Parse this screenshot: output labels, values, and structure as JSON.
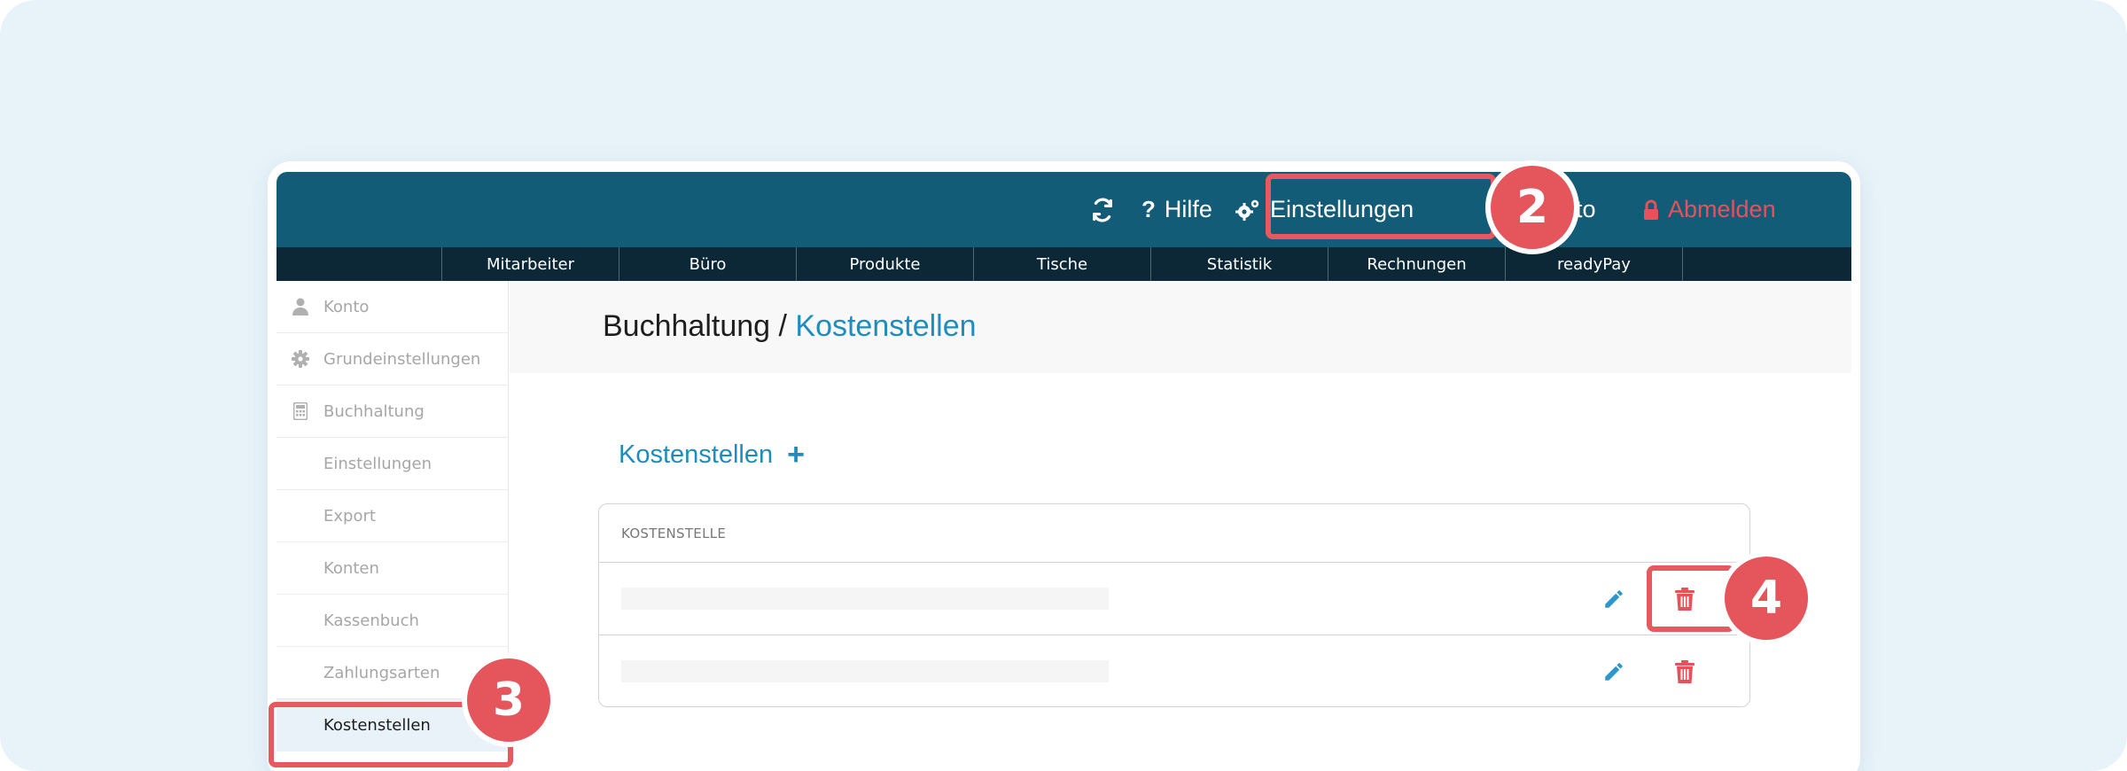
{
  "topbar": {
    "reload_icon": "refresh-icon",
    "help_label": "Hilfe",
    "settings_label": "Einstellungen",
    "account_label_partial": "to",
    "logout_label": "Abmelden"
  },
  "subnav": {
    "items": [
      {
        "label": "Mitarbeiter"
      },
      {
        "label": "Büro"
      },
      {
        "label": "Produkte"
      },
      {
        "label": "Tische"
      },
      {
        "label": "Statistik"
      },
      {
        "label": "Rechnungen"
      },
      {
        "label": "readyPay"
      }
    ]
  },
  "sidebar": {
    "items": [
      {
        "label": "Konto",
        "icon": "user-icon"
      },
      {
        "label": "Grundeinstellungen",
        "icon": "gear-icon"
      },
      {
        "label": "Buchhaltung",
        "icon": "calculator-icon"
      },
      {
        "label": "Einstellungen"
      },
      {
        "label": "Export"
      },
      {
        "label": "Konten"
      },
      {
        "label": "Kassenbuch"
      },
      {
        "label": "Zahlungsarten"
      },
      {
        "label": "Kostenstellen",
        "active": true
      }
    ]
  },
  "page": {
    "breadcrumb_parent": "Buchhaltung",
    "breadcrumb_sep": " / ",
    "breadcrumb_current": "Kostenstellen"
  },
  "section": {
    "title": "Kostenstellen",
    "add_symbol": "+"
  },
  "table": {
    "header": "KOSTENSTELLE",
    "rows": [
      {
        "value": ""
      },
      {
        "value": ""
      }
    ]
  },
  "annotations": {
    "step_2": "2",
    "step_3": "3",
    "step_4": "4"
  },
  "colors": {
    "topbar": "#135c78",
    "subnav": "#0c2837",
    "accent": "#1e8dbd",
    "danger": "#e8515a",
    "highlight": "#e65a5f"
  }
}
